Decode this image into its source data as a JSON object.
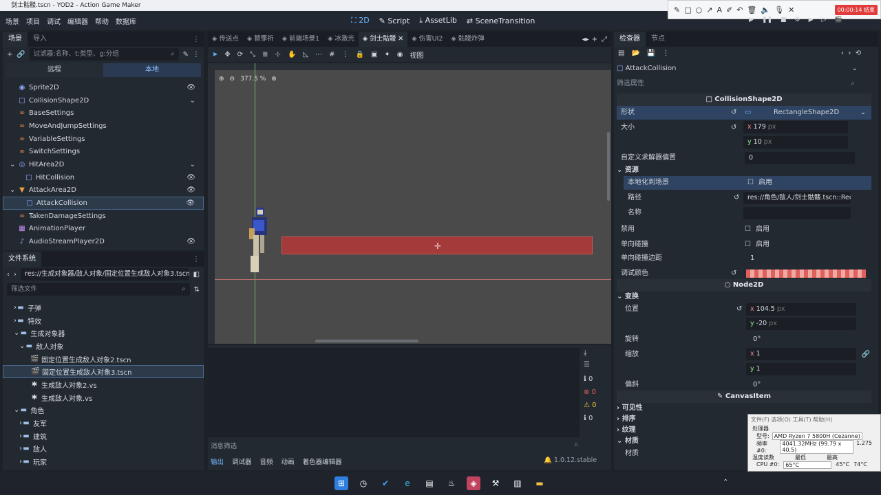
{
  "titlebar": {
    "title": "剑士骷髅.tscn - YOD2 - Action Game Maker",
    "min": "─",
    "max": "▢",
    "close": "✕"
  },
  "menu": {
    "items": [
      "场景",
      "项目",
      "调试",
      "编辑器",
      "帮助",
      "数据库"
    ],
    "modes": [
      "2D",
      "Script",
      "AssetLib",
      "SceneTransition"
    ]
  },
  "recorder": {
    "timer": "00:00:14 结束"
  },
  "scene": {
    "tabs": [
      "场景",
      "导入"
    ],
    "filter_placeholder": "过滤器:名称、t:类型、g:分组",
    "remote": "远程",
    "local": "本地",
    "nodes": [
      {
        "label": "Sprite2D",
        "icon": "◉",
        "color": "#8fa9ff",
        "indent": 22,
        "eye": true
      },
      {
        "label": "CollisionShape2D",
        "icon": "□",
        "color": "#8fa9ff",
        "indent": 22,
        "eye": "chevron"
      },
      {
        "label": "BaseSettings",
        "icon": "∞",
        "color": "#f08a4b",
        "indent": 22
      },
      {
        "label": "MoveAndJumpSettings",
        "icon": "∞",
        "color": "#f08a4b",
        "indent": 22
      },
      {
        "label": "VariableSettings",
        "icon": "∞",
        "color": "#f08a4b",
        "indent": 22
      },
      {
        "label": "SwitchSettings",
        "icon": "∞",
        "color": "#f08a4b",
        "indent": 22
      },
      {
        "label": "HitArea2D",
        "icon": "◎",
        "color": "#8fa9ff",
        "indent": 22,
        "arrow": "⌄",
        "eye": "chevron"
      },
      {
        "label": "HitCollision",
        "icon": "□",
        "color": "#8fa9ff",
        "indent": 32,
        "eye": true
      },
      {
        "label": "AttackArea2D",
        "icon": "▼",
        "color": "#f0a040",
        "indent": 22,
        "arrow": "⌄",
        "eye": true
      },
      {
        "label": "AttackCollision",
        "icon": "□",
        "color": "#8fa9ff",
        "indent": 32,
        "eye": true,
        "selected": true
      },
      {
        "label": "TakenDamageSettings",
        "icon": "∞",
        "color": "#f08a4b",
        "indent": 22
      },
      {
        "label": "AnimationPlayer",
        "icon": "▦",
        "color": "#c790ff",
        "indent": 22
      },
      {
        "label": "AudioStreamPlayer2D",
        "icon": "♪",
        "color": "#8fa9ff",
        "indent": 22,
        "eye": true
      }
    ]
  },
  "fs": {
    "title": "文件系统",
    "path": "res://生成对象器/敌人对象/固定位置生成敌人对象3.tscn",
    "filter_placeholder": "筛选文件",
    "items": [
      {
        "label": "子弹",
        "type": "folder",
        "indent": 16
      },
      {
        "label": "特效",
        "type": "folder",
        "indent": 16
      },
      {
        "label": "生成对象器",
        "type": "folder",
        "indent": 16,
        "open": true
      },
      {
        "label": "敌人对象",
        "type": "folder",
        "indent": 24,
        "open": true
      },
      {
        "label": "固定位置生成敌人对象2.tscn",
        "type": "scene",
        "indent": 40
      },
      {
        "label": "固定位置生成敌人对象3.tscn",
        "type": "scene",
        "indent": 40,
        "selected": true
      },
      {
        "label": "生成敌人对象2.vs",
        "type": "script",
        "indent": 40
      },
      {
        "label": "生成敌人对象.vs",
        "type": "script",
        "indent": 40
      },
      {
        "label": "角色",
        "type": "folder",
        "indent": 16,
        "open": true
      },
      {
        "label": "友军",
        "type": "folder",
        "indent": 24
      },
      {
        "label": "建筑",
        "type": "folder",
        "indent": 24
      },
      {
        "label": "敌人",
        "type": "folder",
        "indent": 24
      },
      {
        "label": "玩家",
        "type": "folder",
        "indent": 24
      }
    ]
  },
  "viewport": {
    "tabs": [
      "传送点",
      "替罪祈",
      "前端场景1",
      "冰激光",
      "剑士骷髅",
      "伤害UI2",
      "骷髅炸弹"
    ],
    "active_tab": 4,
    "zoom": "377.5 %",
    "view_label": "视图"
  },
  "bottom": {
    "msg_filter": "消息筛选",
    "tabs": [
      "输出",
      "调试器",
      "音频",
      "动画",
      "着色器编辑器"
    ],
    "version": "1.0.12.stable",
    "counts": [
      "0",
      "0",
      "0",
      "0"
    ]
  },
  "inspector": {
    "tabs": [
      "检查器",
      "节点"
    ],
    "node": "AttackCollision",
    "filter": "筛选属性",
    "section_collision": "CollisionShape2D",
    "shape_label": "形状",
    "shape_value": "RectangleShape2D",
    "size_label": "大小",
    "size_x": "179",
    "size_y": "10",
    "unit": "px",
    "solver_label": "自定义求解器偏置",
    "solver_value": "0",
    "resource_label": "资源",
    "local_label": "本地化到场景",
    "enable": "启用",
    "path_label": "路径",
    "path_value": "res://角色/敌人/剑士骷髅.tscn::Rect",
    "name_label": "名称",
    "disabled_label": "禁用",
    "oneway_label": "单向碰撞",
    "oneway_margin_label": "单向碰撞边距",
    "oneway_margin_value": "1",
    "debug_color_label": "调试颜色",
    "section_node2d": "Node2D",
    "transform_label": "变换",
    "pos_label": "位置",
    "pos_x": "104.5",
    "pos_y": "-20",
    "rot_label": "旋转",
    "rot_value": "0",
    "deg": "°",
    "scale_label": "缩放",
    "scale_x": "1",
    "scale_y": "1",
    "skew_label": "偏斜",
    "skew_value": "0",
    "section_canvas": "CanvasItem",
    "vis_label": "可见性",
    "order_label": "排序",
    "texture_label": "纹理",
    "material_label": "材质",
    "material_sub": "材质"
  },
  "cpu": {
    "menu": "文件(F)   选项(O)   工具(T)   帮助(H)",
    "proc": "处理器",
    "model_label": "型号:",
    "model": "AMD Ryzen 7 5800H (Cezanne)",
    "freq_label": "频率 #0:",
    "freq": "4041.32MHz (99.79 x 40.5)",
    "freq2": "1.275",
    "temp": "温度读数",
    "max": "最低",
    "low": "最高",
    "cpu_label": "CPU #0:",
    "cpu_val": "65°C",
    "a": "45°C",
    "b": "74°C"
  },
  "colors": {
    "accent": "#70b8ff",
    "selection": "#2d3a4a",
    "collision": "#a53a3a",
    "debug": "#e0605a"
  }
}
